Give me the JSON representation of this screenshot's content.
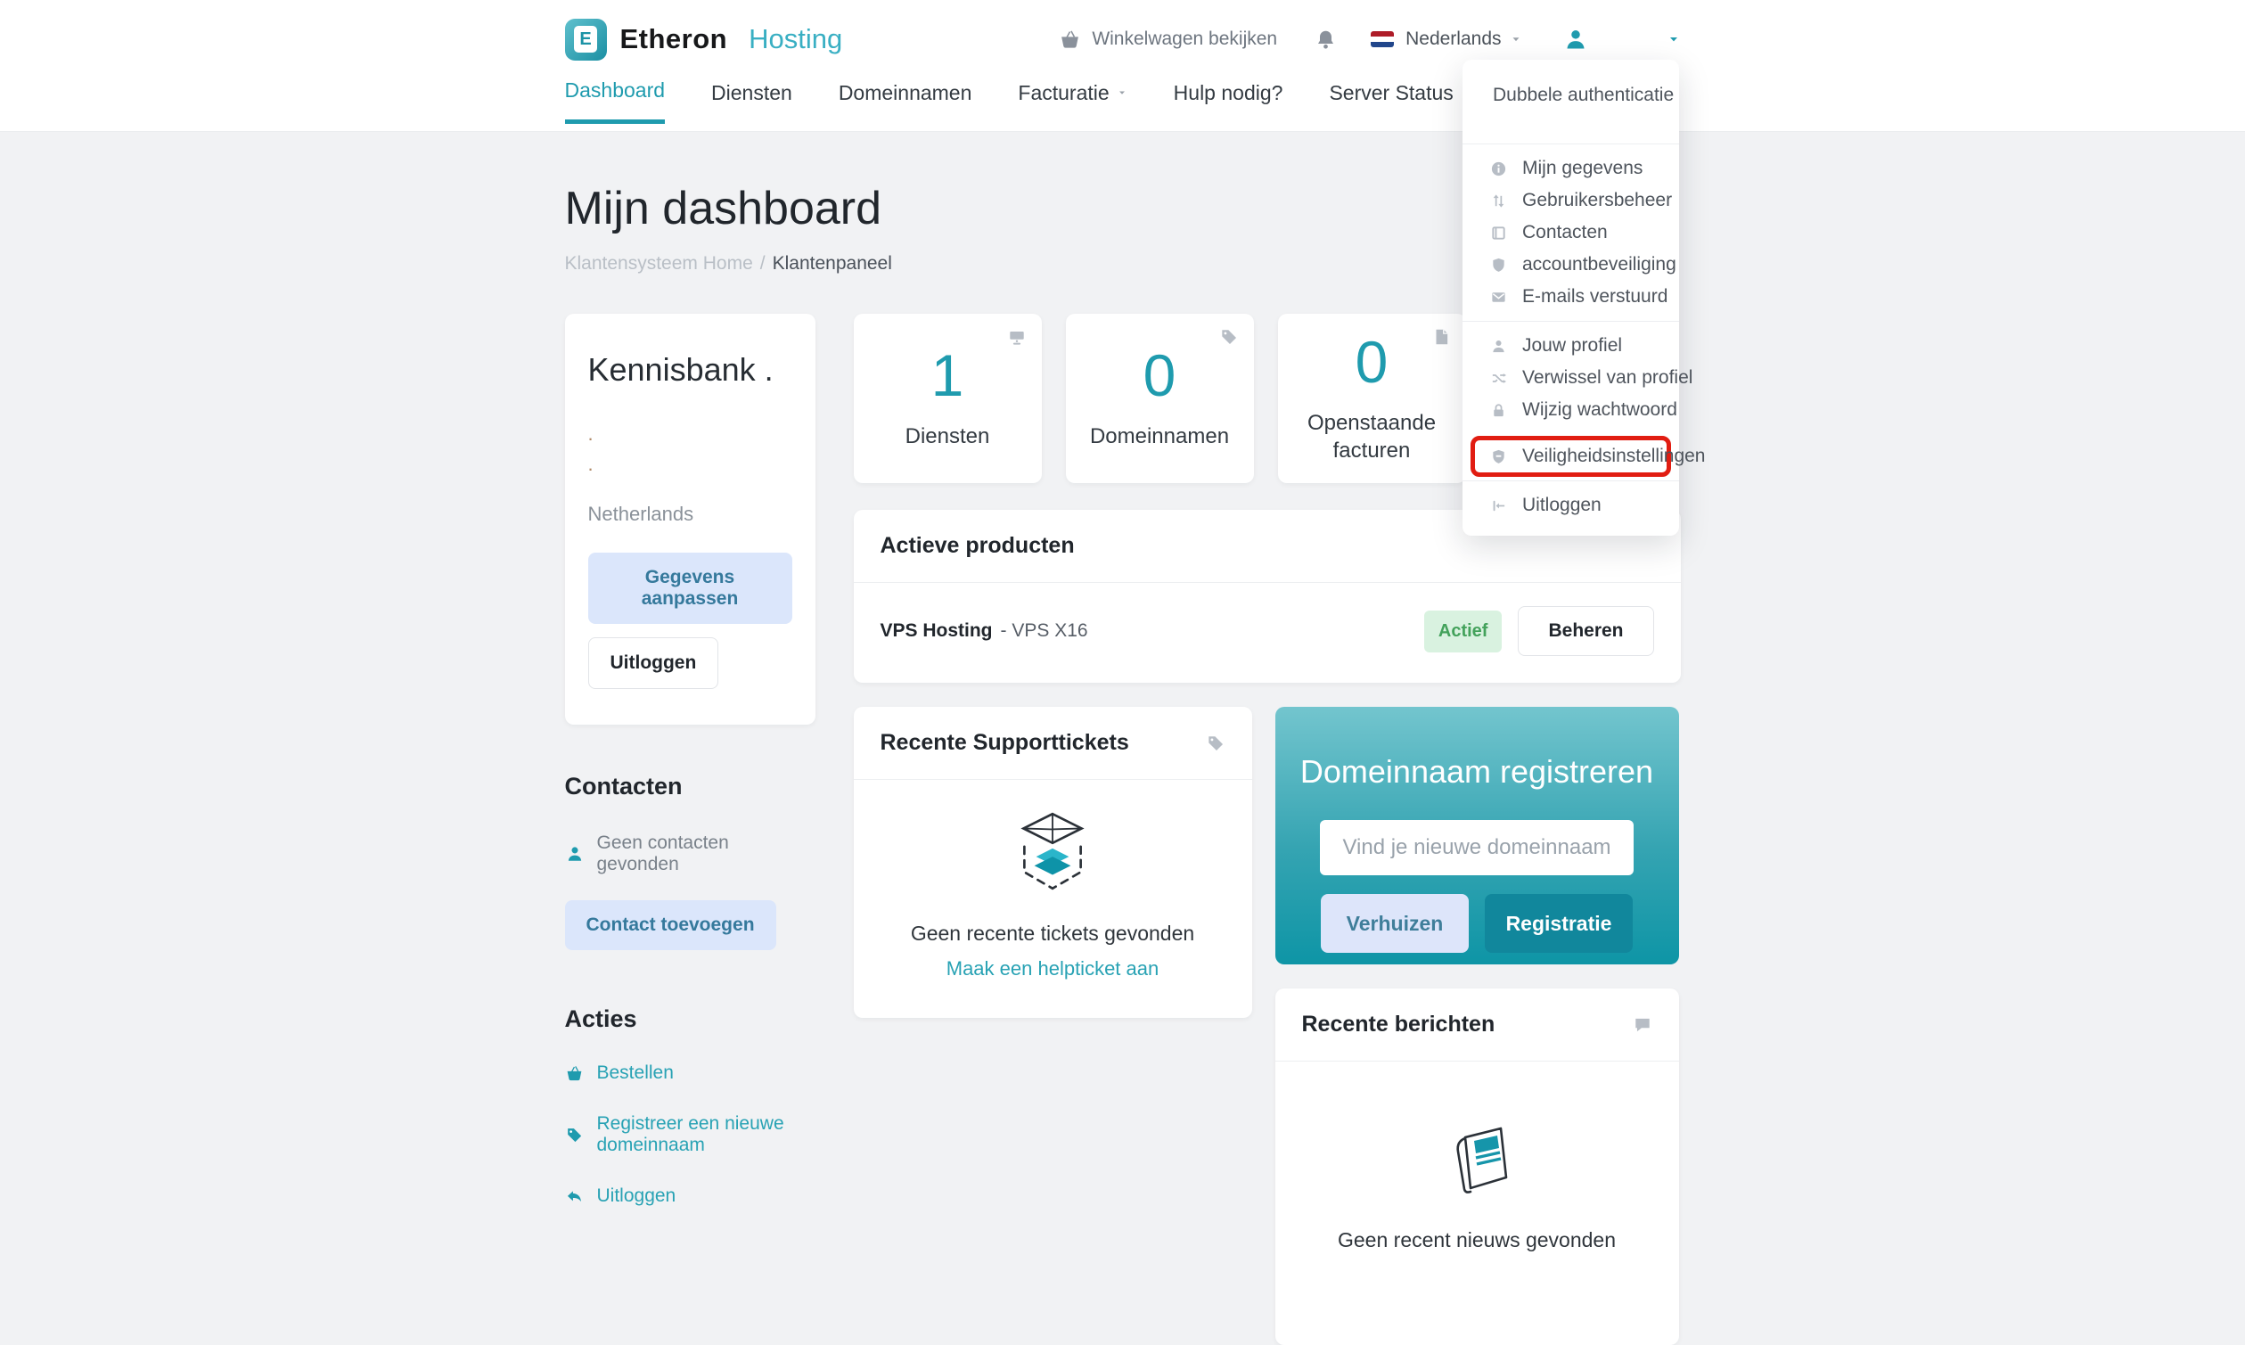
{
  "brand": {
    "letter": "E",
    "primary": "Etheron",
    "secondary": "Hosting",
    "icon": "etheron-logo-icon"
  },
  "navbar": {
    "cart_label": "Winkelwagen bekijken",
    "cart_icon": "basket-icon",
    "bell_icon": "bell-icon",
    "flag_icon": "netherlands-flag-icon",
    "language": "Nederlands",
    "avatar_icon": "user-icon",
    "tabs": [
      {
        "label": "Dashboard",
        "active": true
      },
      {
        "label": "Diensten",
        "active": false
      },
      {
        "label": "Domeinnamen",
        "active": false
      },
      {
        "label": "Facturatie",
        "active": false,
        "caret": true
      },
      {
        "label": "Hulp nodig?",
        "active": false
      },
      {
        "label": "Server Status",
        "active": false
      }
    ]
  },
  "page": {
    "title": "Mijn dashboard",
    "breadcrumb_home": "Klantensysteem Home",
    "breadcrumb_separator": "/",
    "breadcrumb_current": "Klantenpaneel"
  },
  "profile_card": {
    "title": "Kennisbank .",
    "line1": ".",
    "line2": ".",
    "country": "Netherlands",
    "edit_button": "Gegevens aanpassen",
    "logout_button": "Uitloggen"
  },
  "contacts": {
    "title": "Contacten",
    "empty": "Geen contacten gevonden",
    "empty_icon": "user-icon",
    "add_button": "Contact toevoegen"
  },
  "actions": {
    "title": "Acties",
    "items": [
      {
        "label": "Bestellen",
        "icon": "basket-icon"
      },
      {
        "label": "Registreer een nieuwe domeinnaam",
        "icon": "tag-icon"
      },
      {
        "label": "Uitloggen",
        "icon": "reply-arrow-icon"
      }
    ]
  },
  "stats": [
    {
      "value": "1",
      "label": "Diensten",
      "icon": "server-icon"
    },
    {
      "value": "0",
      "label": "Domeinnamen",
      "icon": "tag-icon"
    },
    {
      "value": "0",
      "label": "Openstaande facturen",
      "icon": "file-icon"
    }
  ],
  "active_products": {
    "title": "Actieve producten",
    "product_name": "VPS Hosting",
    "product_detail": "- VPS X16",
    "status_badge": "Actief",
    "manage_button": "Beheren"
  },
  "tickets": {
    "title": "Recente Supporttickets",
    "corner_icon": "tag-icon",
    "empty_illustration": "ticket-box-illustration",
    "empty": "Geen recente tickets gevonden",
    "link": "Maak een helpticket aan"
  },
  "domain_box": {
    "title": "Domeinnaam registreren",
    "placeholder": "Vind je nieuwe domeinnaam",
    "transfer_button": "Verhuizen",
    "register_button": "Registratie"
  },
  "news": {
    "title": "Recente berichten",
    "corner_icon": "chat-icon",
    "empty_illustration": "newspaper-illustration",
    "empty": "Geen recent nieuws gevonden"
  },
  "user_menu": {
    "header": "Dubbele authenticatie",
    "group1": [
      {
        "label": "Mijn gegevens",
        "icon": "info-icon"
      },
      {
        "label": "Gebruikersbeheer",
        "icon": "sort-arrows-icon"
      },
      {
        "label": "Contacten",
        "icon": "contact-card-icon"
      },
      {
        "label": "accountbeveiliging",
        "icon": "shield-icon"
      },
      {
        "label": "E-mails verstuurd",
        "icon": "envelope-icon"
      }
    ],
    "group2": [
      {
        "label": "Jouw profiel",
        "icon": "user-icon"
      },
      {
        "label": "Verwissel van profiel",
        "icon": "shuffle-icon"
      },
      {
        "label": "Wijzig wachtwoord",
        "icon": "lock-icon"
      }
    ],
    "highlighted": {
      "label": "Veiligheidsinstellingen",
      "icon": "shield-badge-icon"
    },
    "logout": {
      "label": "Uitloggen",
      "icon": "logout-icon"
    }
  },
  "colors": {
    "accent_teal": "#1f9bae",
    "accent_dark_teal": "#11879c",
    "highlight_red": "#e11d12",
    "badge_green_bg": "#d9f2e0",
    "badge_green_text": "#43a25b",
    "light_button_bg": "#dbe6fb",
    "light_button_text": "#35799c",
    "background": "#f1f2f4"
  }
}
